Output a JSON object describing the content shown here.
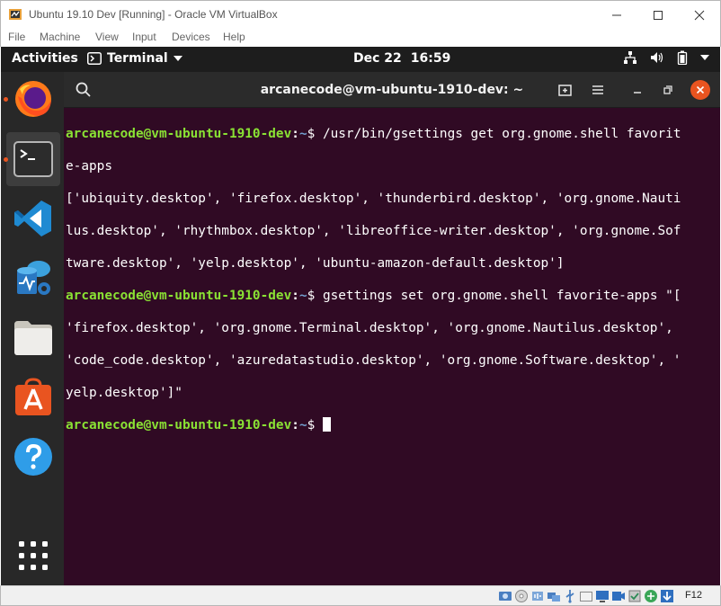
{
  "vbox": {
    "title": "Ubuntu 19.10 Dev [Running] - Oracle VM VirtualBox",
    "menu": [
      "File",
      "Machine",
      "View",
      "Input",
      "Devices",
      "Help"
    ],
    "host_key": "F12"
  },
  "topbar": {
    "activities": "Activities",
    "app_name": "Terminal",
    "date": "Dec 22",
    "time": "16:59"
  },
  "dock": {
    "items": [
      "firefox",
      "terminal",
      "vscode",
      "azure-data-studio",
      "files",
      "software",
      "help",
      "show-applications"
    ]
  },
  "terminal": {
    "title": "arcanecode@vm-ubuntu-1910-dev: ~",
    "prompt_user": "arcanecode@vm-ubuntu-1910-dev",
    "prompt_sep": ":",
    "prompt_path": "~",
    "prompt_symbol": "$",
    "lines": {
      "l1_cmd": " /usr/bin/gsettings get org.gnome.shell favorit",
      "l2": "e-apps",
      "l3": "['ubiquity.desktop', 'firefox.desktop', 'thunderbird.desktop', 'org.gnome.Nauti",
      "l4": "lus.desktop', 'rhythmbox.desktop', 'libreoffice-writer.desktop', 'org.gnome.Sof",
      "l5": "tware.desktop', 'yelp.desktop', 'ubuntu-amazon-default.desktop']",
      "l6_cmd": " gsettings set org.gnome.shell favorite-apps \"[",
      "l7": "'firefox.desktop', 'org.gnome.Terminal.desktop', 'org.gnome.Nautilus.desktop',",
      "l8": "'code_code.desktop', 'azuredatastudio.desktop', 'org.gnome.Software.desktop', '",
      "l9": "yelp.desktop']\"",
      "l10_cmd": " "
    }
  },
  "colors": {
    "terminal_bg": "#300a24",
    "prompt_user": "#8ae234",
    "prompt_path": "#729fcf",
    "accent": "#e95420"
  }
}
